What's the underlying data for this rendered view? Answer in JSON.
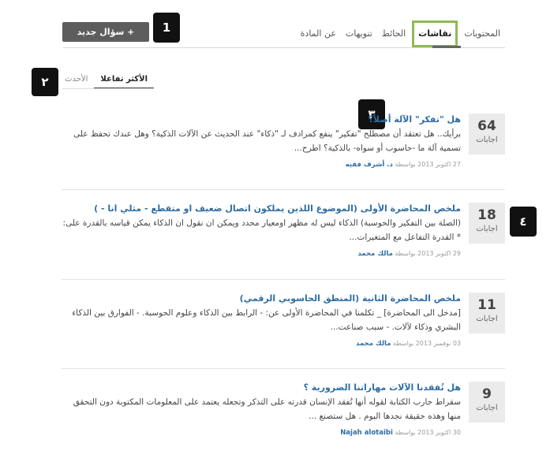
{
  "nav": {
    "tabs": [
      {
        "label": "المحتويات"
      },
      {
        "label": "نقاشات"
      },
      {
        "label": "الحائط"
      },
      {
        "label": "تنويهات"
      },
      {
        "label": "عن المادة"
      }
    ]
  },
  "new_question_label": "+ سؤال جديد",
  "markers": [
    "1",
    "٢",
    "٣",
    "٤"
  ],
  "sort": {
    "tabs": [
      {
        "label": "الأكثر تفاعلا"
      },
      {
        "label": "الأحدث"
      }
    ]
  },
  "discussions": [
    {
      "count": "64",
      "count_label": "اجابات",
      "title": "هل \"تفكر\" الآلة أصلاً؟",
      "excerpt": "برأيك.. هل تعتقد أن مصطلح \"تفكير\" ينفع كمرادف لـ \"ذكاء\" عند الحديث عن الآلات الذكية؟ وهل عندك تحفظ على تسمية آلة ما -حاسوب أو سواه- بالذكية؟ اطرح...",
      "meta_date": "27 اكتوبر 2013 بواسطة",
      "author": "د. أشرف فقيه"
    },
    {
      "count": "18",
      "count_label": "اجابات",
      "title": "ملخص المحاضرة الأولى (الموضوع اللذين يملكون اتصال ضعيف او متقطع - مثلي انا - )",
      "excerpt": "(الصلة بين التفكير والحوسبة) الذكاء ليس له مظهر اومعيار محدد ويمكن ان نقول ان الذكاء يمكن قياسه بالقدرة على: * القدرة التفاعل مع المتغيرات...",
      "meta_date": "29 اكتوبر 2013 بواسطة",
      "author": "مالك محمد"
    },
    {
      "count": "11",
      "count_label": "اجابات",
      "title": "ملخص المحاضرة الثانية (المنطق الحاسوبي الرقمي)",
      "excerpt": "[مدخل الى المحاضرة] _ تكلمنا في المحاضرة الأولى عن: - الرابط بين الذكاء وعلوم الحوسبة. - الفوارق بين الذكاء البشري وذكاء لآلات. - سبب صناعت...",
      "meta_date": "03 نوفمبر 2013 بواسطة",
      "author": "مالك محمد"
    },
    {
      "count": "9",
      "count_label": "اجابات",
      "title": "هل تُفقدنا الآلات مهاراتنا الضرورية ؟",
      "excerpt": "سقراط حارب الكتابة لقوله أنها تُفقد الإنسان قدرته على التذكر وتجعله يعتمد على المعلومات المكتوبة دون التحقق منها وهذه حقيقة نجدها اليوم . هل ستصنع ...",
      "meta_date": "30 اكتوبر 2013 بواسطة",
      "author": "Najah alotaibi"
    }
  ]
}
